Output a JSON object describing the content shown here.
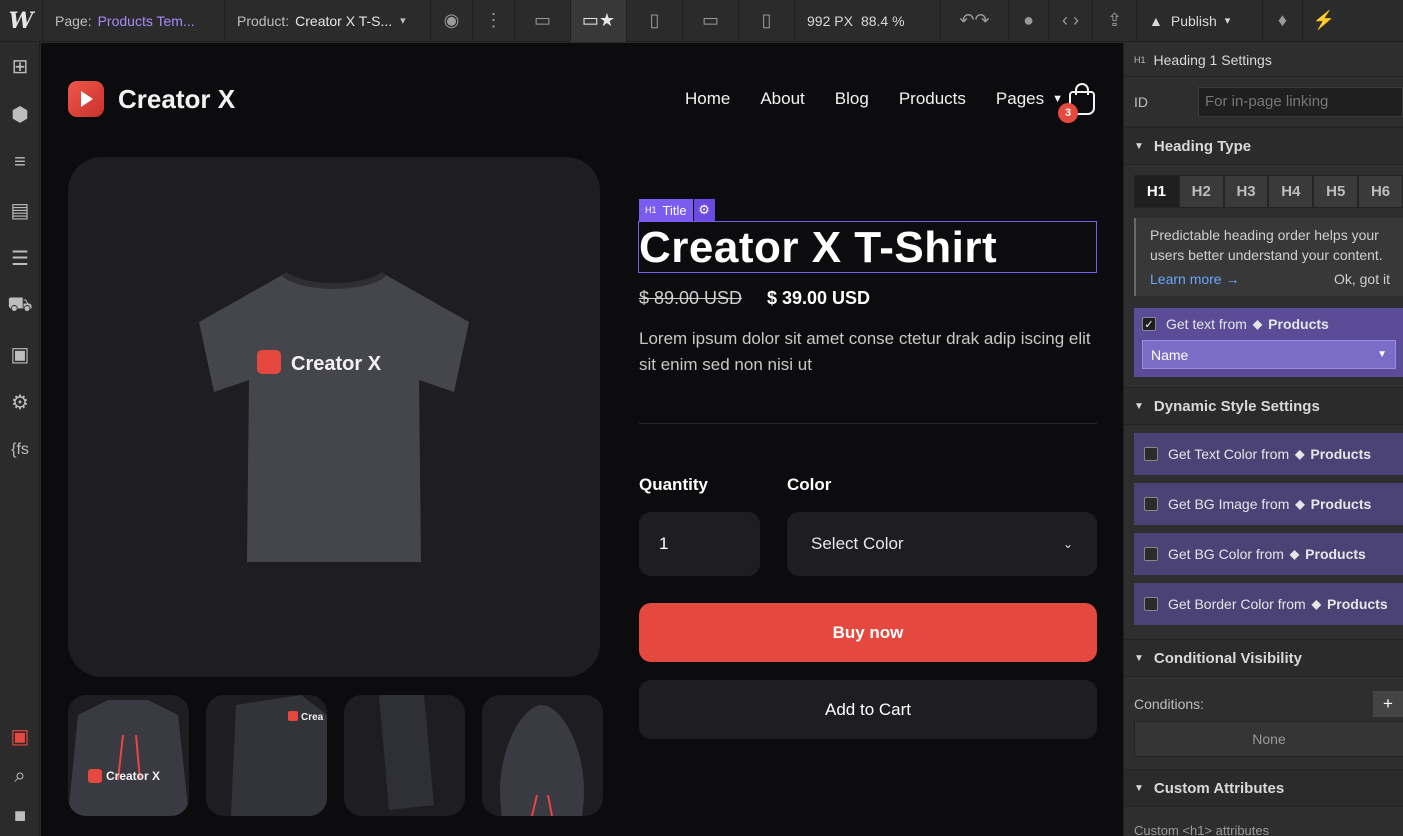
{
  "topbar": {
    "page_key": "Page:",
    "page_value": "Products Tem...",
    "product_key": "Product:",
    "product_value": "Creator X T-S...",
    "width_px": "992 PX",
    "zoom": "88.4 %",
    "publish_label": "Publish"
  },
  "site": {
    "brand_name": "Creator X",
    "nav": [
      "Home",
      "About",
      "Blog",
      "Products",
      "Pages"
    ],
    "cart_count": "3",
    "tshirt_logo_text": "Creator X",
    "thumb_logo_text": "Creator X",
    "thumb2_logo_text": "Crea",
    "selection_tag_prefix": "H1",
    "selection_tag_label": "Title",
    "product_title": "Creator X T-Shirt",
    "price_old": "$ 89.00 USD",
    "price_new": "$ 39.00 USD",
    "description": "Lorem ipsum dolor sit amet conse ctetur drak adip iscing elit sit enim sed non nisi ut",
    "quantity_label": "Quantity",
    "color_label": "Color",
    "quantity_value": "1",
    "color_placeholder": "Select Color",
    "buy_label": "Buy now",
    "add_cart_label": "Add to Cart"
  },
  "panel": {
    "header_prefix": "H1",
    "header": "Heading 1 Settings",
    "id_label": "ID",
    "id_placeholder": "For in-page linking",
    "heading_type_title": "Heading Type",
    "heading_tabs": [
      "H1",
      "H2",
      "H3",
      "H4",
      "H5",
      "H6"
    ],
    "hint_text": "Predictable heading order helps your users better understand your content.",
    "hint_learn": "Learn more →",
    "hint_ok": "Ok, got it",
    "get_text_label": "Get text from",
    "collection": "Products",
    "name_select": "Name",
    "dynamic_title": "Dynamic Style Settings",
    "dynamic_options": [
      "Get Text Color from",
      "Get BG Image from",
      "Get BG Color from",
      "Get Border Color from"
    ],
    "conditional_title": "Conditional Visibility",
    "conditions_label": "Conditions:",
    "conditions_value": "None",
    "custom_title": "Custom Attributes",
    "custom_footer": "Custom <h1> attributes"
  },
  "colors": {
    "accent_red": "#e5483f",
    "selection_purple": "#7c5cf0",
    "dynamic_purple": "#5a4c96"
  }
}
